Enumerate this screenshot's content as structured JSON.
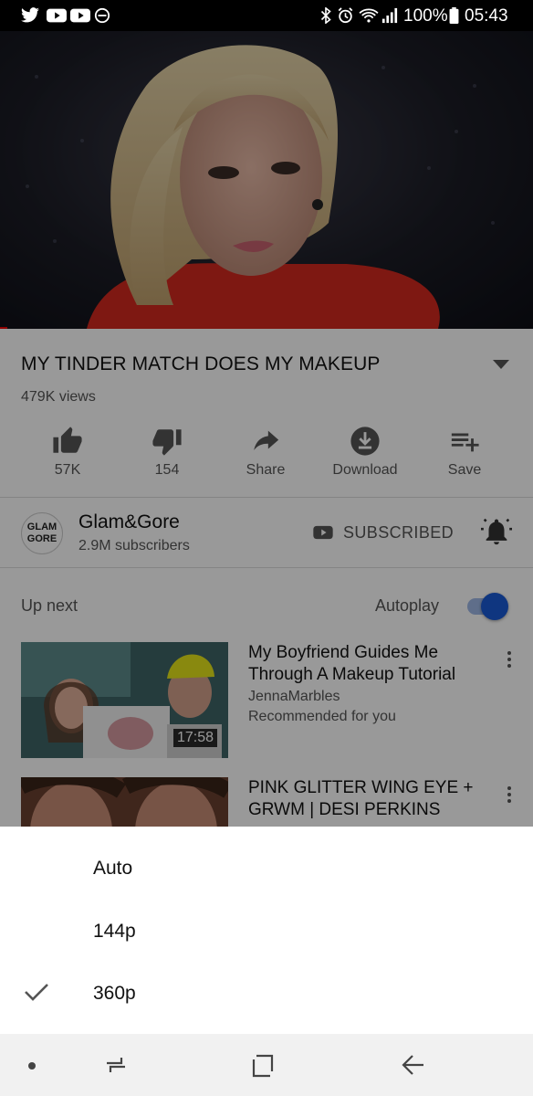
{
  "status_bar": {
    "battery_text": "100%",
    "time": "05:43",
    "left_icons": [
      "twitter-icon",
      "youtube-icon",
      "youtube-icon",
      "do-not-disturb-icon"
    ],
    "right_icons": [
      "bluetooth-icon",
      "alarm-icon",
      "wifi-icon",
      "signal-icon",
      "battery-icon"
    ]
  },
  "video": {
    "title": "MY TINDER MATCH DOES MY MAKEUP",
    "views": "479K views",
    "progress_fraction": 0.014
  },
  "actions": [
    {
      "label": "57K",
      "icon": "thumbs-up-icon"
    },
    {
      "label": "154",
      "icon": "thumbs-down-icon"
    },
    {
      "label": "Share",
      "icon": "share-icon"
    },
    {
      "label": "Download",
      "icon": "download-icon"
    },
    {
      "label": "Save",
      "icon": "playlist-add-icon"
    }
  ],
  "channel": {
    "logo_text": "GLAM GORE",
    "name": "Glam&Gore",
    "subscribers": "2.9M subscribers",
    "subscribed_label": "SUBSCRIBED"
  },
  "up_next": {
    "label": "Up next",
    "autoplay_label": "Autoplay",
    "autoplay_on": true
  },
  "videos": [
    {
      "title": "My Boyfriend Guides Me Through A Makeup Tutorial",
      "channel": "JennaMarbles",
      "meta": "Recommended for you",
      "duration": "17:58"
    },
    {
      "title": "PINK GLITTER WING EYE + GRWM | DESI PERKINS",
      "channel": "",
      "meta": "",
      "duration": ""
    }
  ],
  "quality_sheet": {
    "options": [
      "Auto",
      "144p",
      "360p"
    ],
    "selected": "360p"
  },
  "colors": {
    "accent_blue": "#1a5ad6",
    "progress_red": "#ee0000",
    "overlay": "rgba(0,0,0,0.4)"
  }
}
